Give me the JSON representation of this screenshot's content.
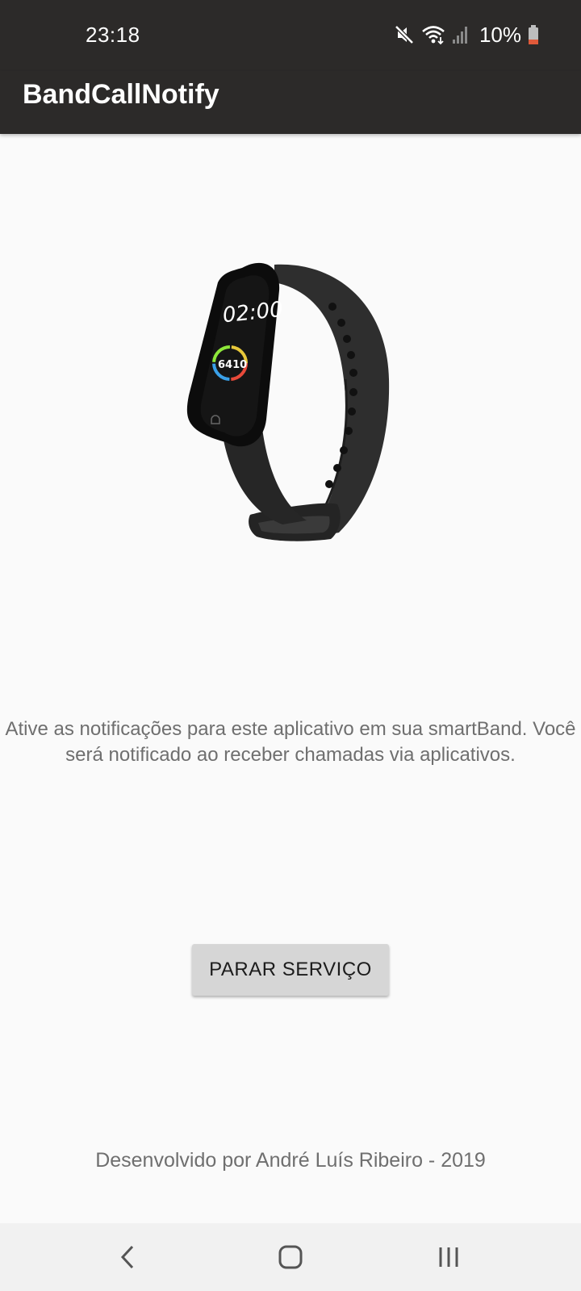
{
  "status_bar": {
    "time": "23:18",
    "battery": "10%",
    "icons": [
      "mute-icon",
      "wifi-icon",
      "signal-icon",
      "battery-icon"
    ]
  },
  "app_bar": {
    "title": "BandCallNotify"
  },
  "main": {
    "image_icon": "smart-band-illustration",
    "band_time": "02:00",
    "band_steps": "6410",
    "description": "Ative as notificações para este aplicativo em sua smartBand. Você será notificado ao receber chamadas via aplicativos.",
    "button_label": "PARAR SERVIÇO",
    "footer": "Desenvolvido por André Luís Ribeiro - 2019"
  },
  "nav_bar": {
    "buttons": [
      "back-icon",
      "home-icon",
      "recents-icon"
    ]
  },
  "colors": {
    "bar_background": "#2c2a29",
    "page_background": "#fafafa",
    "button_background": "#d6d6d6",
    "battery_low": "#e05a3a"
  }
}
